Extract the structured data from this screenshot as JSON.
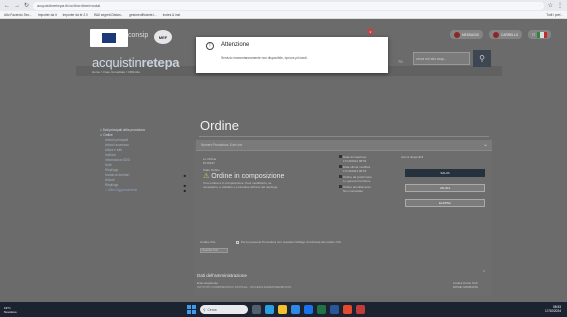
{
  "browser": {
    "url": "acquistinretepa.it/oc/#/ordine/modal",
    "bookmarks": [
      "Alto Facendo Sec...",
      "Importer da it",
      "Importer da te 2.0",
      "INAI segreti-Distan...",
      "gestoreufficiante.i...",
      "inotes & inst"
    ],
    "other_bookmarks": "Tutti i pref..."
  },
  "site": {
    "brand_consip": "consip",
    "brand_mef": "MEF",
    "brand_mef_sub": "Ministero dell'Economia",
    "title_part1": "acquistin",
    "title_part2": "retepa",
    "breadcrumb": "Home > Fase Immediata > Difficolta",
    "search_placeholder": "cerca nel sito acqu...",
    "search_label": "TO",
    "pill_message": "MESSAGGI",
    "pill_cart": "CARRELLO",
    "cart_count": "2",
    "pill_lang": "IT"
  },
  "leftmenu": {
    "section": "> Dati principali della procedura",
    "root": "∨ Ordine",
    "items": [
      "Articoli principali",
      "Articoli accessori",
      "Allora e tutti",
      "Indirizzi",
      "Informazioni SDG",
      "Note",
      "Riepilogo"
    ],
    "locked_1": "Inviato ai fornitori",
    "locked_1b": "Articoli",
    "locked_2": "Riepilogo",
    "link": "> Ultimi Aggiornamenti"
  },
  "main": {
    "title": "Ordine",
    "panel_header": "Numero Procedura: 8 del xxx",
    "order_label": "Lo Ordine",
    "order_no": "8716347",
    "status_label": "Stato Ordine",
    "status_value": "Ordine in composizione",
    "status_desc_1": "Il tuo ordine è in composizione. Puoi modificarlo, se",
    "status_desc_2": "necessario, e validarlo e procedere all'invio del riepilogo.",
    "dates": [
      {
        "label": "Data di creazione",
        "value": "17/10/2024 08:53"
      },
      {
        "label": "Data ultima modifica",
        "value": "17/10/2024 08:53"
      },
      {
        "label": "Ordine da preliminare",
        "value": "Lo genera il fornitore"
      },
      {
        "label": "Ordine annullamento",
        "value": "Non consultato"
      }
    ],
    "actions_title": "Azioni disponibili",
    "actions": [
      "SALVA",
      "VALIDA",
      "ELIMINA"
    ],
    "cig_label": "Codice CIG",
    "cig_placeholder": "Inserisci CIG",
    "cig_check": "Per la presente Procedura non sussiste l'obbligo di richiesta del codice CIG",
    "amm_title": "Dati dell'amministrazione",
    "amm_label": "Ente acquirente",
    "amm_value": "ISTITUTO COMPRENSIVO STATALE - NOCERA INFERIORE/MOSTA",
    "amm_right_1": "Codice Punto Ordi",
    "amm_right_2": "NOME NOMINATA"
  },
  "dialog": {
    "title": "Attenzione",
    "message": "Servizio momentaneamente non disponibile, riprova più tardi."
  },
  "taskbar": {
    "weather_temp": "19°C",
    "weather_desc": "Nuvoloso",
    "search": "Cerca",
    "time": "08:53",
    "date": "17/10/2024"
  },
  "colors": {
    "accent_blue": "#1c3a7a",
    "dark_button": "#25313d",
    "warning": "#e4c46a"
  }
}
